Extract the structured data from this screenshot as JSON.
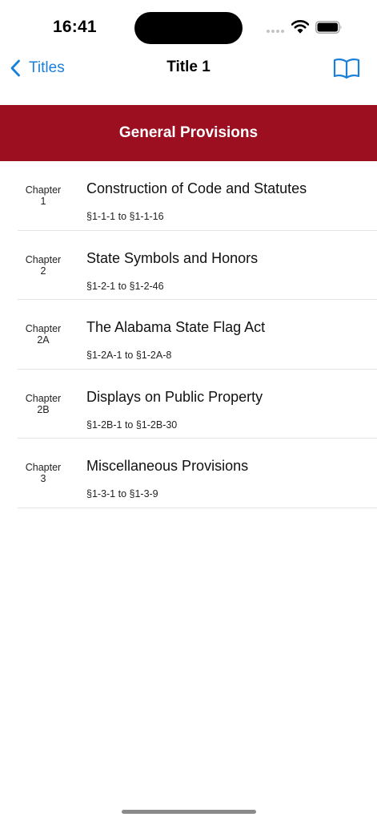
{
  "status_bar": {
    "time": "16:41"
  },
  "nav": {
    "back_label": "Titles",
    "title": "Title 1",
    "back_icon": "chevron-left-icon",
    "right_icon": "book-icon"
  },
  "banner": {
    "title": "General Provisions"
  },
  "chapters": [
    {
      "label_top": "Chapter",
      "number": "1",
      "title": "Construction of Code and Statutes",
      "range": "§1-1-1 to §1-1-16"
    },
    {
      "label_top": "Chapter",
      "number": "2",
      "title": "State Symbols and Honors",
      "range": "§1-2-1 to §1-2-46"
    },
    {
      "label_top": "Chapter",
      "number": "2A",
      "title": "The Alabama State Flag Act",
      "range": "§1-2A-1 to §1-2A-8"
    },
    {
      "label_top": "Chapter",
      "number": "2B",
      "title": "Displays on Public Property",
      "range": "§1-2B-1 to §1-2B-30"
    },
    {
      "label_top": "Chapter",
      "number": "3",
      "title": "Miscellaneous Provisions",
      "range": "§1-3-1 to §1-3-9"
    }
  ],
  "colors": {
    "accent": "#1a7fd8",
    "banner": "#9b0f20",
    "divider": "#e4e4e4"
  }
}
